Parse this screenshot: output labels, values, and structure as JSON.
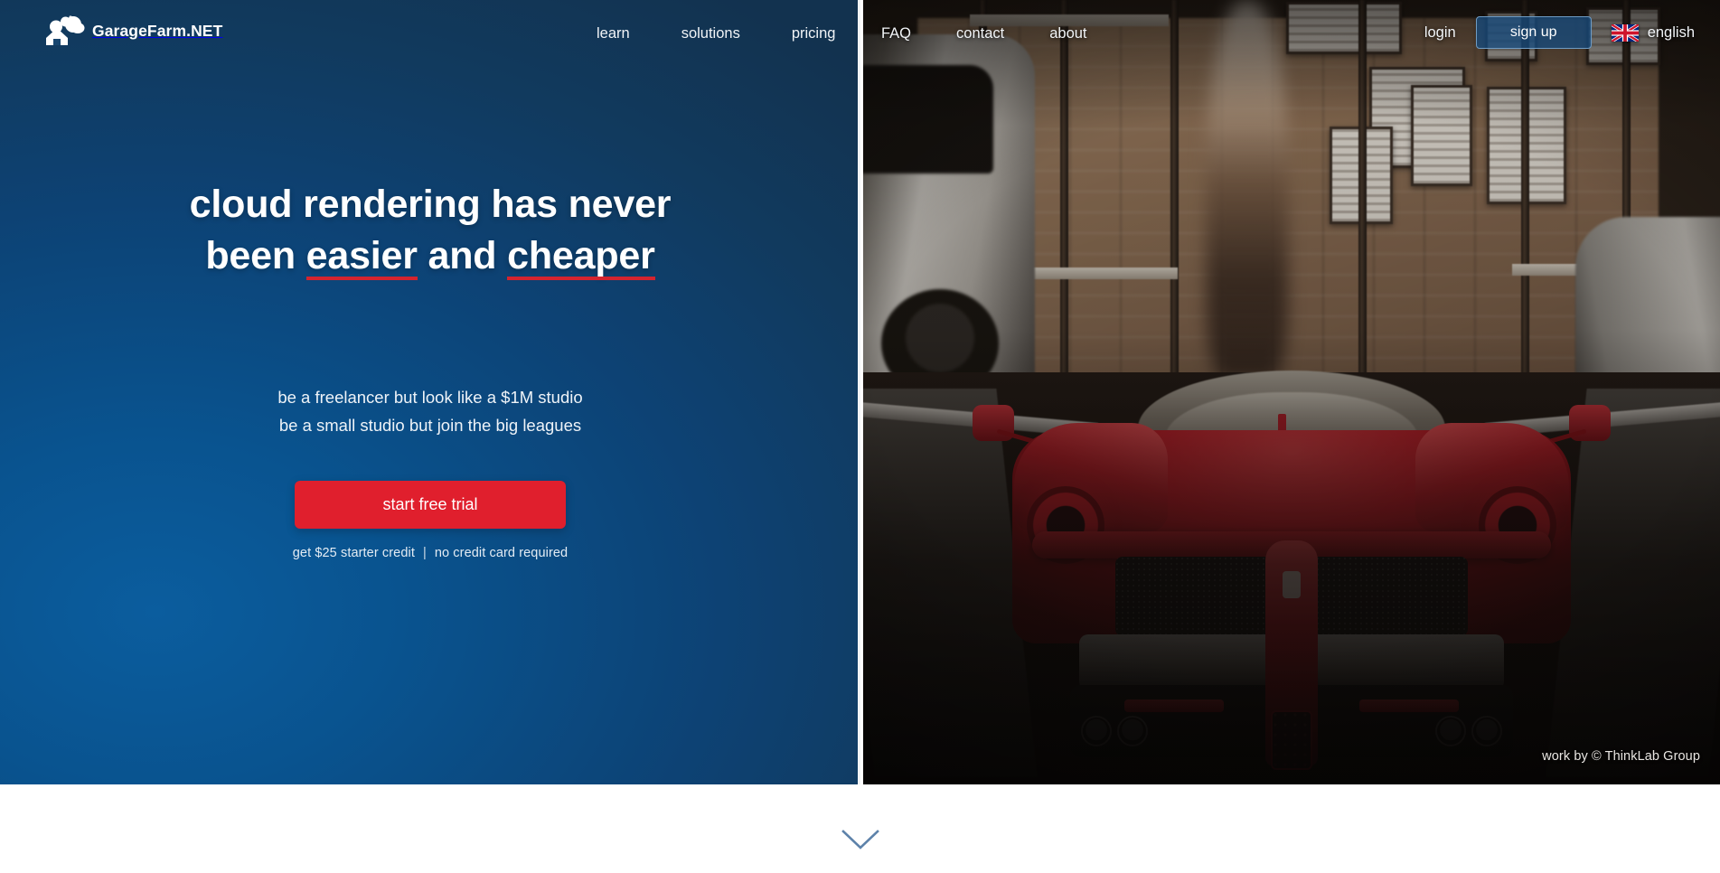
{
  "brand": {
    "name": "GarageFarm.NET",
    "logo_icon": "garage-cloud-logo-icon"
  },
  "nav": {
    "left_items": [
      {
        "label": "learn"
      },
      {
        "label": "solutions"
      },
      {
        "label": "pricing"
      }
    ],
    "right_items": [
      {
        "label": "FAQ"
      },
      {
        "label": "contact"
      },
      {
        "label": "about"
      }
    ]
  },
  "account": {
    "login_label": "login",
    "signup_label": "sign up",
    "language_label": "english",
    "flag_icon": "uk-flag-icon"
  },
  "hero": {
    "headline_line1": "cloud rendering has never",
    "headline_line2_pre": "been ",
    "headline_line2_em1": "easier",
    "headline_line2_mid": " and ",
    "headline_line2_em2": "cheaper",
    "subhead_line1": "be a freelancer but look like a $1M studio",
    "subhead_line2": "be a small studio but join the big leagues",
    "cta_label": "start free trial",
    "cta_note_left": "get $25 starter credit",
    "cta_note_sep": "|",
    "cta_note_right": "no credit card required",
    "photo_credit": "work by © ThinkLab Group"
  },
  "scroll": {
    "chevron_icon": "chevron-down-icon"
  },
  "colors": {
    "brand_blue_dark": "#12324f",
    "brand_blue_light": "#0b5d9e",
    "accent_red": "#e01f2d",
    "underline_red": "#d4242f",
    "chevron_blue": "#5d82aa",
    "white": "#ffffff"
  }
}
